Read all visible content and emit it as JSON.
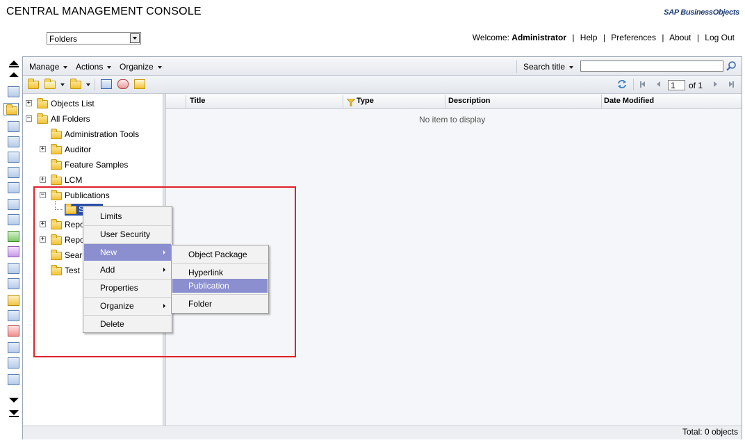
{
  "app": {
    "title": "CENTRAL MANAGEMENT CONSOLE",
    "brand": "SAP BusinessObjects"
  },
  "view_select": {
    "value": "Folders"
  },
  "topnav": {
    "welcome": "Welcome:",
    "user": "Administrator",
    "links": [
      "Help",
      "Preferences",
      "About",
      "Log Out"
    ],
    "separator": "|"
  },
  "menubar": {
    "items": [
      "Manage",
      "Actions",
      "Organize"
    ],
    "search_label": "Search title",
    "search_value": ""
  },
  "pagination": {
    "page": "1",
    "of_label": "of 1"
  },
  "tree": {
    "nodes": [
      "Objects List",
      "All Folders",
      "Administration Tools",
      "Auditor",
      "Feature Samples",
      "LCM",
      "Publications",
      "S",
      "Repo",
      "Repo",
      "Sear",
      "Test"
    ]
  },
  "list": {
    "columns": [
      "Title",
      "Type",
      "Description",
      "Date Modified"
    ],
    "empty_message": "No item to display"
  },
  "status": {
    "total": "Total: 0 objects"
  },
  "context_menu": {
    "items": [
      "Limits",
      "User Security",
      "New",
      "Add",
      "Properties",
      "Organize",
      "Delete"
    ],
    "highlighted": "New"
  },
  "submenu": {
    "items": [
      "Object Package",
      "Hyperlink",
      "Publication",
      "Folder"
    ],
    "highlighted": "Publication"
  },
  "colors": {
    "highlight": "#8b8fd0",
    "selection": "#2b4fa8",
    "annotation": "#e0202a",
    "folder": "#f3c233"
  }
}
